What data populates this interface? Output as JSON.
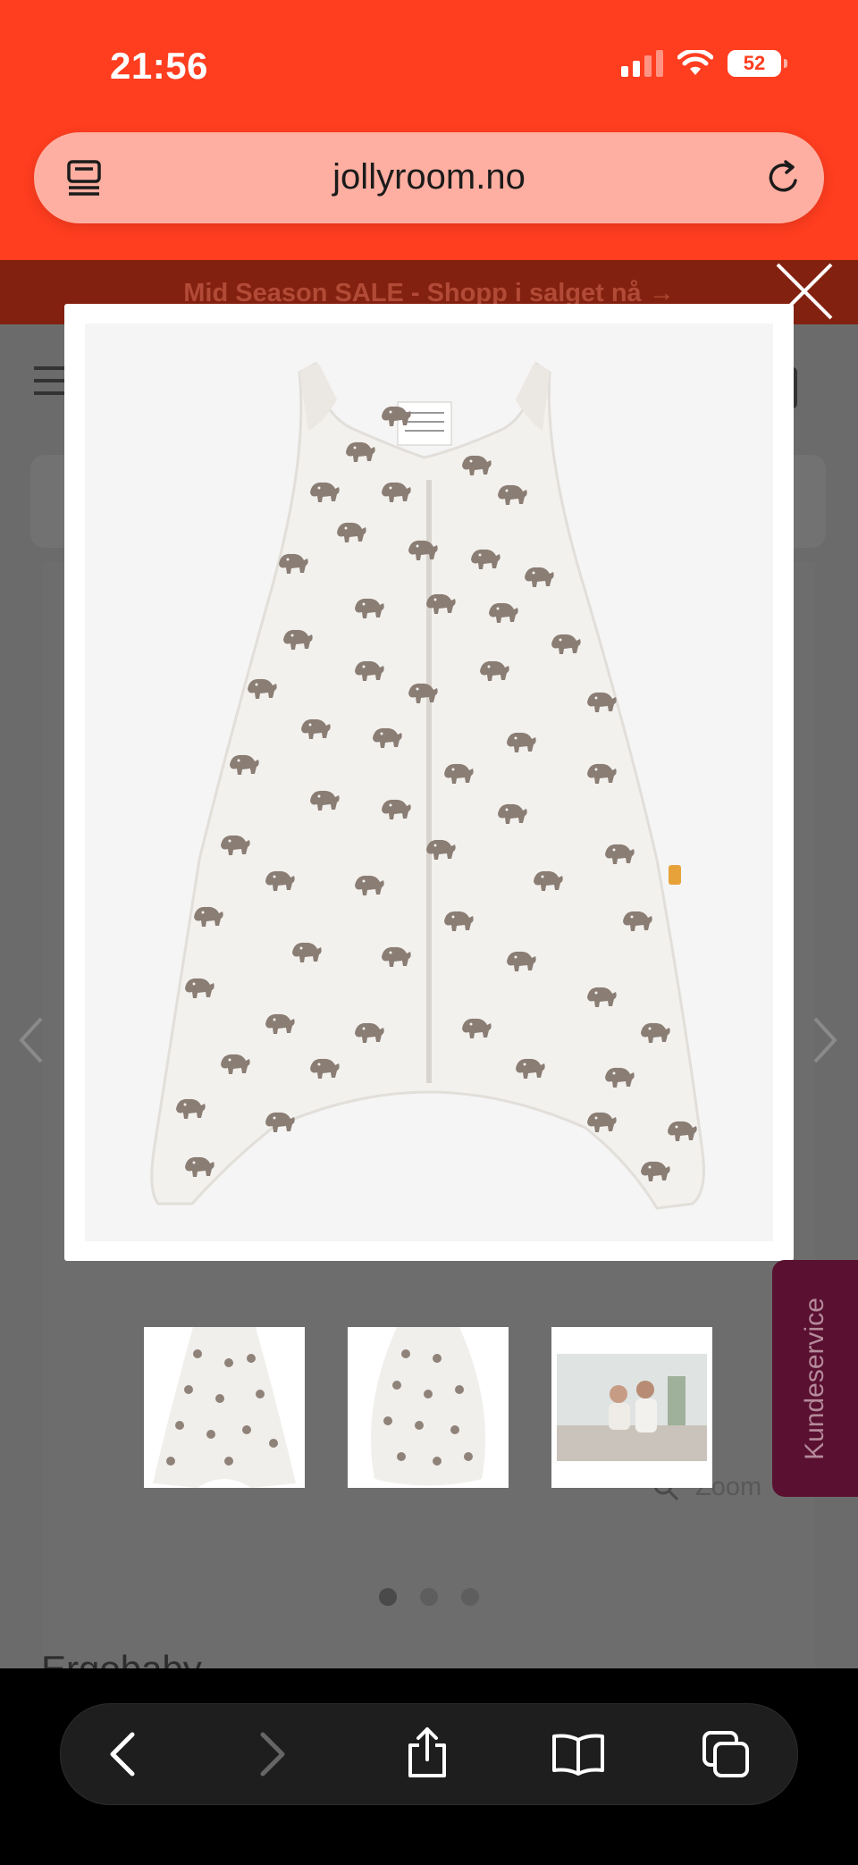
{
  "status_bar": {
    "time": "21:56",
    "battery": "52"
  },
  "browser": {
    "url": "jollyroom.no"
  },
  "page": {
    "promo_text": "Mid Season SALE - Shopp i salget nå →",
    "zoom_label": "Zoom",
    "brand_name": "Ergobaby",
    "carousel": {
      "count": 3,
      "active_index": 0
    }
  },
  "lightbox": {
    "main_image_desc": "product-image-sleep-suit-elephants",
    "thumbnails": [
      {
        "name": "thumbnail-sleep-suit-front"
      },
      {
        "name": "thumbnail-sleep-bag-front"
      },
      {
        "name": "thumbnail-lifestyle-photo"
      }
    ]
  },
  "chat_widget": {
    "label": "Kundeservice"
  },
  "colors": {
    "brand_orange": "#ff3d1f",
    "promo_bg": "#82210f",
    "kundeservice_bg": "#5a1030",
    "elephant": "#8a7d74"
  }
}
